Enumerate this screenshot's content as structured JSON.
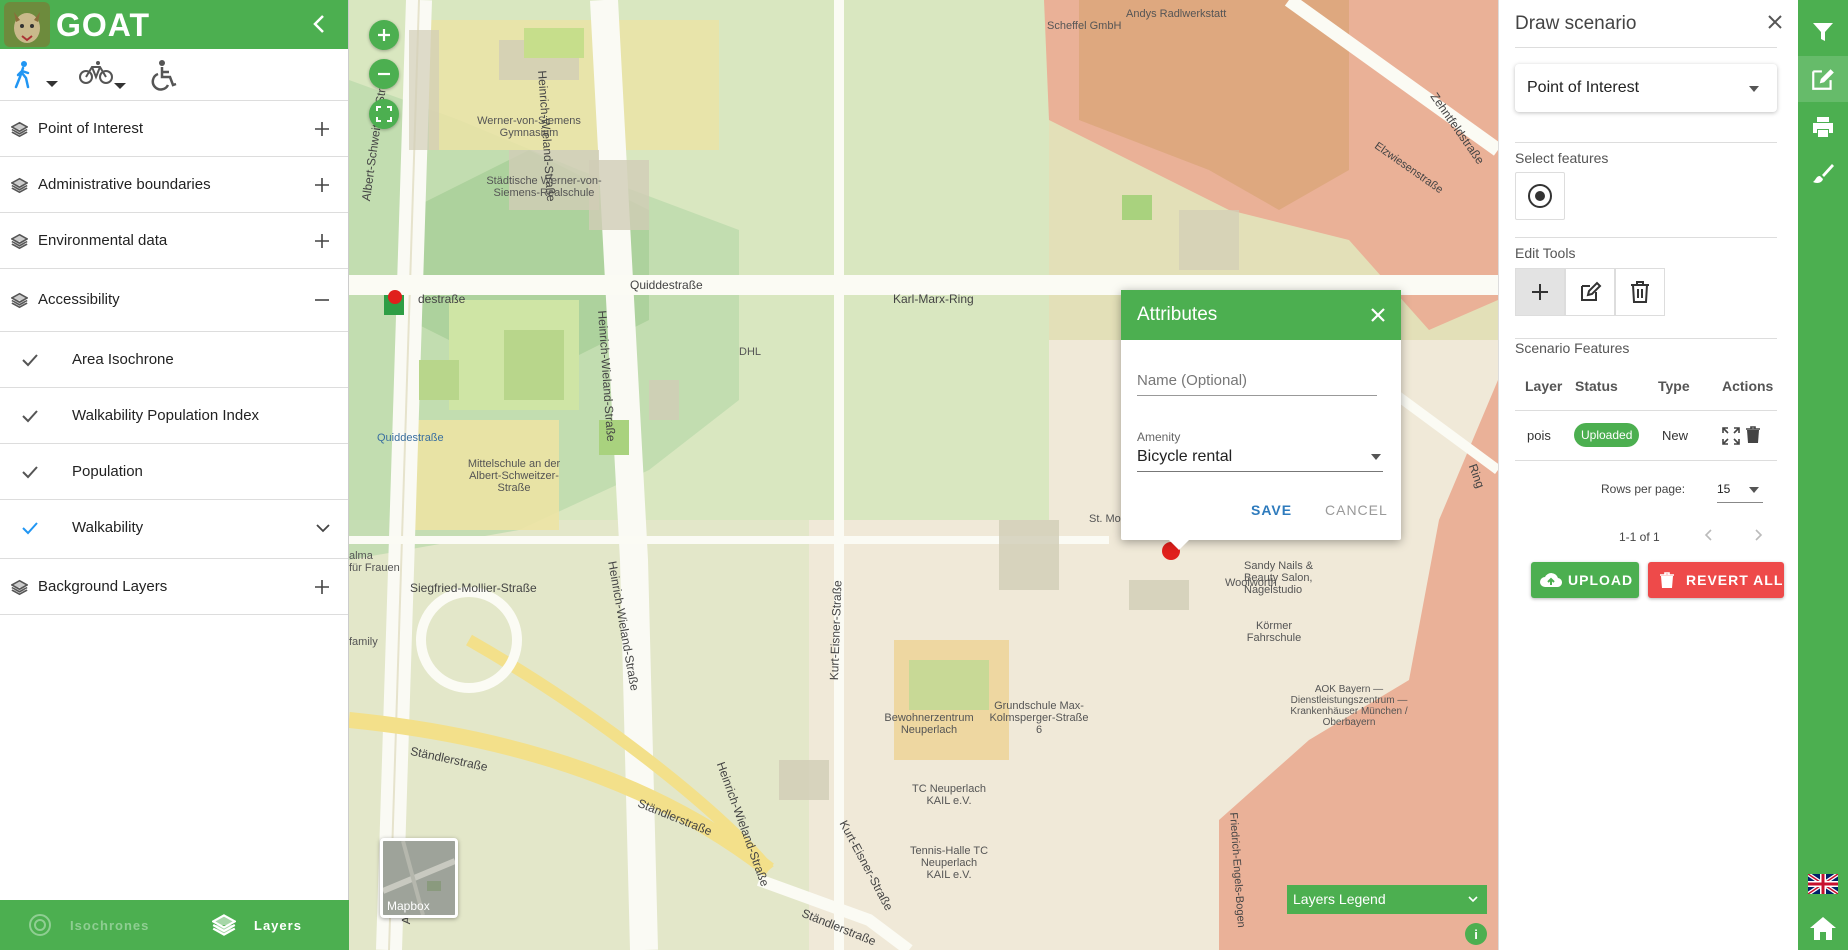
{
  "app": {
    "logo_text": "GOAT",
    "brand_color": "#4caf50"
  },
  "sidebar": {
    "collapse_icon": "chevron-left-icon",
    "modes": [
      "walking-icon",
      "bicycle-icon",
      "wheelchair-icon"
    ],
    "groups": [
      {
        "label": "Point of Interest",
        "expanded": false
      },
      {
        "label": "Administrative boundaries",
        "expanded": false
      },
      {
        "label": "Environmental data",
        "expanded": false
      },
      {
        "label": "Accessibility",
        "expanded": true
      },
      {
        "label": "Background Layers",
        "expanded": false
      }
    ],
    "accessibility_items": [
      {
        "label": "Area Isochrone",
        "checked": true
      },
      {
        "label": "Walkability Population Index",
        "checked": true
      },
      {
        "label": "Population",
        "checked": true
      },
      {
        "label": "Walkability",
        "checked": true,
        "active": true
      }
    ],
    "footer": {
      "isochrones_label": "Isochrones",
      "layers_label": "Layers"
    }
  },
  "map": {
    "labels": {
      "scheffel": "Scheffel GmbH",
      "andys": "Andys Radlwerkstatt",
      "gymnasium": "Werner-von-Siemens Gymnasium",
      "realschule": "Städtische Werner-von-Siemens-Realschule",
      "quiddestrasse_poi": "Quiddestraße",
      "mittelschule": "Mittelschule an der Albert-Schweitzer-Straße",
      "dhl": "DHL",
      "woolworth": "Woolworth",
      "sandy": "Sandy Nails & Beauty Salon, Nagelstudio",
      "koermer": "Körmer Fahrschule",
      "aok": "AOK Bayern — Dienstleistungszentrum — Krankenhäuser München / Oberbayern",
      "bewohnerzentrum": "Bewohnerzentrum Neuperlach",
      "grundschule": "Grundschule Max-Kolmsperger-Straße 6",
      "tc_neuperlach": "TC Neuperlach KAIL e.V.",
      "tennis": "Tennis-Halle TC Neuperlach KAIL e.V.",
      "st_mon": "St. Mon",
      "alma": "alma",
      "fuer_frauen": "für Frauen",
      "family": "family"
    },
    "streets": {
      "quiddestrasse_1": "Quiddestraße",
      "quiddestrasse_2": "destraße",
      "karl_marx_ring": "Karl-Marx-Ring",
      "albert_schweitzer": "Albert-Schweitzer-Straße",
      "heinrich_wieland_1": "Heinrich-Wieland-Straße",
      "heinrich_wieland_2": "Heinrich-Wieland-Straße",
      "heinrich_wieland_3": "Heinrich-Wieland-Straße",
      "heinrich_wieland_4": "Heinrich-Wieland-Straße",
      "siegfried": "Siegfried-Mollier-Straße",
      "kurt_eisner_1": "Kurt-Eisner-Straße",
      "kurt_eisner_2": "Kurt-Eisner-Straße",
      "staendler_1": "Ständlerstraße",
      "staendler_2": "Ständlerstraße",
      "staendler_3": "Ständlerstraße",
      "zehntfeld": "Zehntfeldstraße",
      "elzwiesen": "Elzwiesenstraße",
      "friedrich_engels": "Friedrich-Engels-Bogen",
      "ring": "Ring",
      "alb": "Alb"
    },
    "controls": {
      "zoom_in": "+",
      "zoom_out": "−"
    },
    "basemap_label": "Mapbox",
    "legend_label": "Layers Legend",
    "info_label": "i"
  },
  "popup": {
    "title": "Attributes",
    "name_placeholder": "Name (Optional)",
    "amenity_label": "Amenity",
    "amenity_value": "Bicycle rental",
    "save_label": "SAVE",
    "cancel_label": "CANCEL"
  },
  "draw_panel": {
    "title": "Draw scenario",
    "layer_select_value": "Point of Interest",
    "select_features_label": "Select features",
    "edit_tools_label": "Edit Tools",
    "scenario_features_label": "Scenario Features",
    "table": {
      "headers": [
        "Layer",
        "Status",
        "Type",
        "Actions"
      ],
      "rows": [
        {
          "layer": "pois",
          "status": "Uploaded",
          "type": "New"
        }
      ]
    },
    "rows_per_page_label": "Rows per page:",
    "rows_per_page_value": "15",
    "page_info": "1-1 of 1",
    "upload_label": "UPLOAD",
    "revert_label": "REVERT ALL",
    "upload_color": "#4caf50",
    "revert_color": "#ee4a4a"
  },
  "toolbar": {
    "icons": [
      "filter-icon",
      "edit-icon",
      "print-icon",
      "brush-icon",
      "uk-flag-icon",
      "home-icon"
    ]
  }
}
